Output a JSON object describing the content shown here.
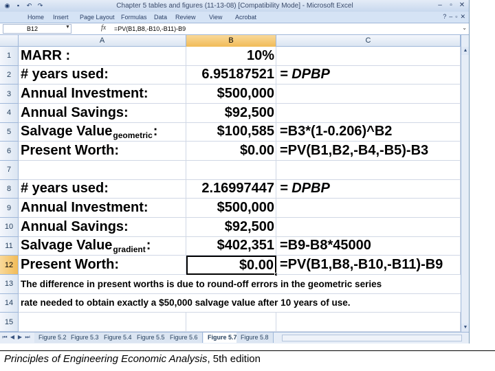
{
  "window": {
    "title": "Chapter 5 tables and figures (11-13-08)  [Compatibility Mode]  -  Microsoft Excel",
    "controls": [
      "–",
      "▫",
      "✕"
    ]
  },
  "menu": {
    "tabs": [
      "Home",
      "Insert",
      "Page Layout",
      "Formulas",
      "Data",
      "Review",
      "View",
      "Acrobat"
    ],
    "help": [
      "?",
      "–",
      "▫",
      "✕"
    ]
  },
  "formula_bar": {
    "name_box": "B12",
    "fx": "fx",
    "formula": "=PV(B1,B8,-B10,-B11)-B9"
  },
  "columns": [
    "A",
    "B",
    "C"
  ],
  "active_column": "B",
  "rows": [
    {
      "num": "1",
      "a": "MARR :",
      "a_sub": "",
      "a_tail": "",
      "b": "10%",
      "c": ""
    },
    {
      "num": "2",
      "a": "# years used:",
      "a_sub": "",
      "a_tail": "",
      "b": "6.95187521",
      "c": "= DPBP"
    },
    {
      "num": "3",
      "a": "Annual Investment:",
      "a_sub": "",
      "a_tail": "",
      "b": "$500,000",
      "c": ""
    },
    {
      "num": "4",
      "a": "Annual Savings:",
      "a_sub": "",
      "a_tail": "",
      "b": "$92,500",
      "c": ""
    },
    {
      "num": "5",
      "a": "Salvage Value",
      "a_sub": "geometric",
      "a_tail": ":",
      "b": "$100,585",
      "c": "=B3*(1-0.206)^B2"
    },
    {
      "num": "6",
      "a": "Present Worth:",
      "a_sub": "",
      "a_tail": "",
      "b": "$0.00",
      "c": "=PV(B1,B2,-B4,-B5)-B3"
    },
    {
      "num": "7",
      "a": "",
      "a_sub": "",
      "a_tail": "",
      "b": "",
      "c": ""
    },
    {
      "num": "8",
      "a": "# years used:",
      "a_sub": "",
      "a_tail": "",
      "b": "2.16997447",
      "c": "= DPBP"
    },
    {
      "num": "9",
      "a": "Annual Investment:",
      "a_sub": "",
      "a_tail": "",
      "b": "$500,000",
      "c": ""
    },
    {
      "num": "10",
      "a": "Annual Savings:",
      "a_sub": "",
      "a_tail": "",
      "b": "$92,500",
      "c": ""
    },
    {
      "num": "11",
      "a": "Salvage Value",
      "a_sub": "gradient",
      "a_tail": ":",
      "b": "$402,351",
      "c": "=B9-B8*45000"
    },
    {
      "num": "12",
      "a": "Present Worth:",
      "a_sub": "",
      "a_tail": "",
      "b": "$0.00",
      "c": "=PV(B1,B8,-B10,-B11)-B9"
    },
    {
      "num": "13",
      "note": "The difference in present worths is due to round-off errors in the geometric series"
    },
    {
      "num": "14",
      "note": "rate needed to obtain exactly a $50,000 salvage value after 10 years of use."
    },
    {
      "num": "15",
      "a": "",
      "a_sub": "",
      "a_tail": "",
      "b": "",
      "c": ""
    }
  ],
  "active_row": "12",
  "sheet_tabs": [
    "Figure 5.2",
    "Figure 5.3",
    "Figure 5.4",
    "Figure 5.5",
    "Figure 5.6",
    "Figure 5.7",
    "Figure 5.8"
  ],
  "active_sheet": "Figure 5.7",
  "caption": {
    "title": "Principles of Engineering Economic Analysis",
    "edition": ", 5th edition"
  }
}
